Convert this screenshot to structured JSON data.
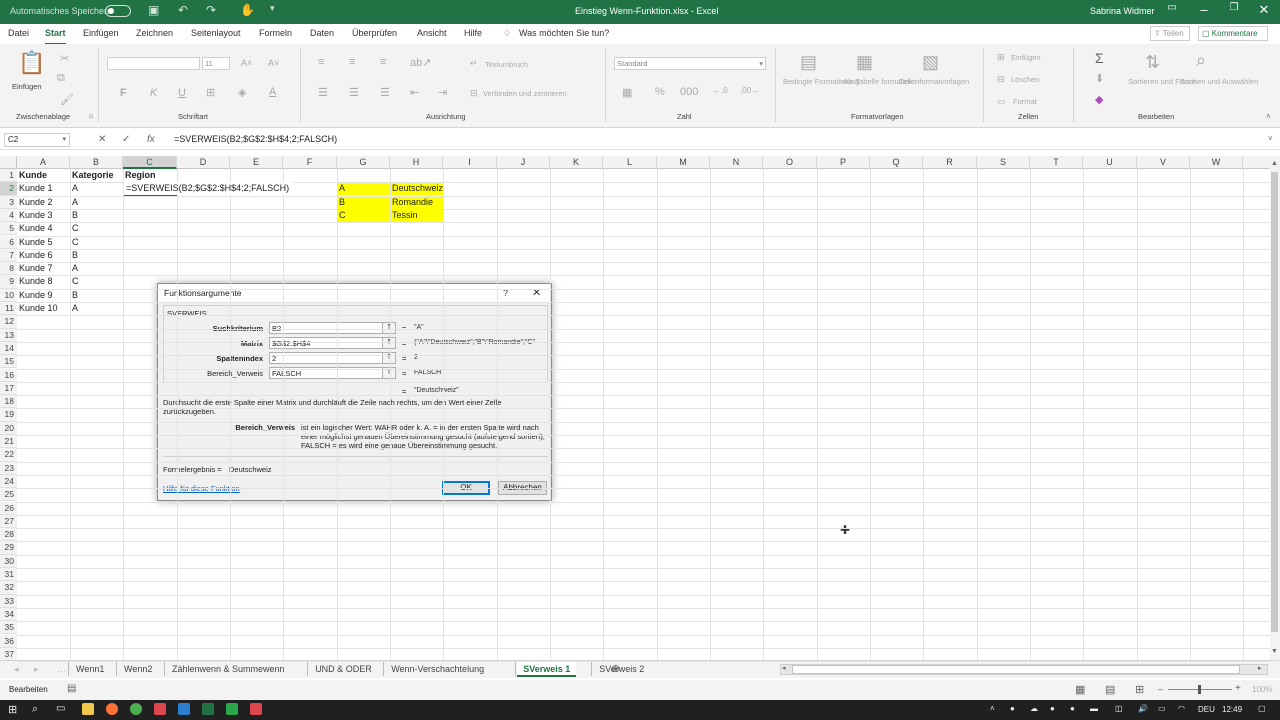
{
  "title_bar": {
    "autosave_label": "Automatisches Speichern",
    "document_title": "Einstieg Wenn-Funktion.xlsx  -  Excel",
    "user_name": "Sabrina Widmer"
  },
  "menu": {
    "items": [
      "Datei",
      "Start",
      "Einfügen",
      "Zeichnen",
      "Seitenlayout",
      "Formeln",
      "Daten",
      "Überprüfen",
      "Ansicht",
      "Hilfe"
    ],
    "search_placeholder": "Was möchten Sie tun?",
    "share_label": "Teilen",
    "comments_label": "Kommentare"
  },
  "ribbon": {
    "clipboard": {
      "paste_label": "Einfügen",
      "group": "Zwischenablage"
    },
    "font": {
      "size": "11",
      "group": "Schriftart",
      "bold": "F",
      "italic": "K",
      "underline": "U"
    },
    "alignment": {
      "wrap": "Textumbruch",
      "merge": "Verbinden und zentrieren",
      "group": "Ausrichtung"
    },
    "number": {
      "format": "Standard",
      "group": "Zahl"
    },
    "styles": {
      "conditional": "Bedingte Formatierung",
      "as_table": "Als Tabelle formatieren",
      "cell_styles": "Zellenformatvorlagen",
      "group": "Formatvorlagen"
    },
    "cells": {
      "insert": "Einfügen",
      "delete": "Löschen",
      "format": "Format",
      "group": "Zellen"
    },
    "editing": {
      "sort": "Sortieren und Filtern",
      "find": "Suchen und Auswählen",
      "group": "Bearbeiten"
    }
  },
  "formula_bar": {
    "name_box": "C2",
    "formula": "=SVERWEIS(B2;$G$2:$H$4;2;FALSCH)",
    "fx": "fx"
  },
  "columns": [
    "A",
    "B",
    "C",
    "D",
    "E",
    "F",
    "G",
    "H",
    "I",
    "J",
    "K",
    "L",
    "M",
    "N",
    "O",
    "P",
    "Q",
    "R",
    "S",
    "T",
    "U",
    "V",
    "W"
  ],
  "rows": [
    "1",
    "2",
    "3",
    "4",
    "5",
    "6",
    "7",
    "8",
    "9",
    "10",
    "11",
    "12",
    "13",
    "14",
    "15",
    "16",
    "17",
    "18",
    "19",
    "20",
    "21",
    "22",
    "23",
    "24",
    "25",
    "26",
    "27",
    "28",
    "29",
    "30",
    "31",
    "32",
    "33",
    "34",
    "35",
    "36",
    "37"
  ],
  "cells": {
    "headers": {
      "kunde": "Kunde",
      "kategorie": "Kategorie",
      "region": "Region"
    },
    "customers": [
      "Kunde 1",
      "Kunde 2",
      "Kunde 3",
      "Kunde 4",
      "Kunde 5",
      "Kunde 6",
      "Kunde 7",
      "Kunde 8",
      "Kunde 9",
      "Kunde 10"
    ],
    "categories": [
      "A",
      "A",
      "B",
      "C",
      "C",
      "B",
      "A",
      "C",
      "B",
      "A"
    ],
    "c2_edit": "=SVERWEIS(B2;$G$2:$H$4;2;FALSCH)",
    "lookup_keys": [
      "A",
      "B",
      "C"
    ],
    "lookup_regions": [
      "Deutschweiz",
      "Romandie",
      "Tessin"
    ],
    "lookup_fill": "#ffff00"
  },
  "dialog": {
    "title": "Funktionsargumente",
    "help_icon": "?",
    "function_name": "SVERWEIS",
    "args": [
      {
        "label": "Suchkriterium",
        "value": "B2",
        "result": "\"A\""
      },
      {
        "label": "Matrix",
        "value": "$G$2:$H$4",
        "result": "{\"A\"\\\"Deutschweiz\";\"B\"\\\"Romandie\";\"C\""
      },
      {
        "label": "Spaltenindex",
        "value": "2",
        "result": "2"
      },
      {
        "label": "Bereich_Verweis",
        "value": "FALSCH",
        "result": "FALSCH"
      }
    ],
    "overall_result": "\"Deutschweiz\"",
    "description": "Durchsucht die erste Spalte einer Matrix und durchläuft die Zeile nach rechts, um den Wert einer Zelle zurückzugeben.",
    "arg_help_label": "Bereich_Verweis",
    "arg_help_text": "ist ein logischer Wert: WAHR oder k. A. = in der ersten Spalte wird nach einer möglichst genauen Übereinstimmung gesucht (aufsteigend sortiert); FALSCH = es wird eine genaue Übereinstimmung gesucht.",
    "formula_result_label": "Formelergebnis =",
    "formula_result_value": "Deutschweiz",
    "help_link": "Hilfe für diese Funktion",
    "ok": "OK",
    "cancel": "Abbrechen"
  },
  "sheet_tabs": [
    "Wenn1",
    "Wenn2",
    "Zählenwenn & Summewenn",
    "UND & ODER",
    "Wenn-Verschachtelung",
    "SVerweis 1",
    "SVerweis 2"
  ],
  "active_tab": "SVerweis 1",
  "status": {
    "mode": "Bearbeiten",
    "zoom": "100%"
  },
  "taskbar": {
    "language": "DEU",
    "time": "12:49"
  },
  "colors": {
    "excel_green": "#217346"
  }
}
